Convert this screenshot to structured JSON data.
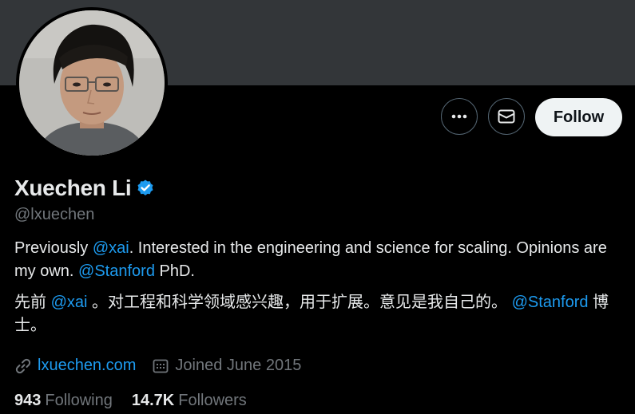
{
  "profile": {
    "name": "Xuechen Li",
    "handle": "@lxuechen",
    "verified_color": "#1d9bf0",
    "bio_en": {
      "p1": "Previously ",
      "mention1": "@xai",
      "p2": ". Interested in the engineering and science for scaling. Opinions are my own. ",
      "mention2": "@Stanford",
      "p3": " PhD."
    },
    "bio_cn": {
      "p1": "先前 ",
      "mention1": "@xai",
      "p2": " 。对工程和科学领域感兴趣，用于扩展。意见是我自己的。 ",
      "mention2": "@Stanford",
      "p3": " 博士。"
    },
    "website": "lxuechen.com",
    "joined": "Joined June 2015",
    "following_count": "943",
    "following_label": "Following",
    "followers_count": "14.7K",
    "followers_label": "Followers"
  },
  "actions": {
    "more_icon": "more-horizontal-icon",
    "message_icon": "envelope-icon",
    "follow_label": "Follow"
  },
  "colors": {
    "background": "#000000",
    "banner": "#333639",
    "text_primary": "#e7e9ea",
    "text_secondary": "#71767b",
    "link": "#1d9bf0",
    "follow_bg": "#eff3f4"
  }
}
